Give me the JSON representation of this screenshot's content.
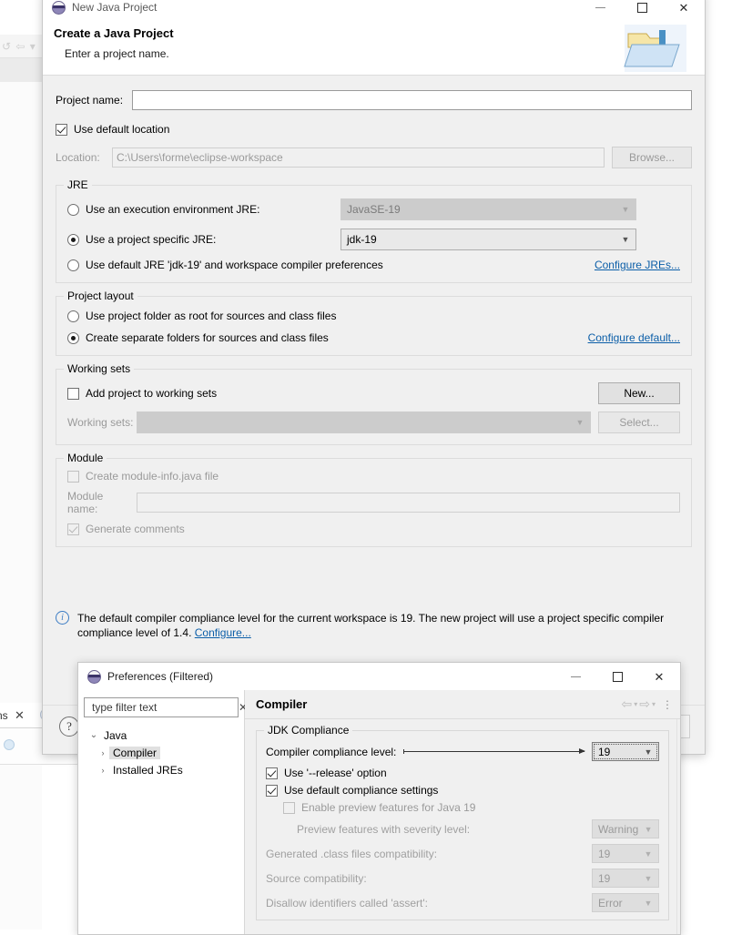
{
  "background": {
    "editor_tab_label": "ns",
    "editor_tab_close": "✕",
    "toolbar_glyphs": "↺ ⇦ ▾"
  },
  "wizard": {
    "window_title": "New Java Project",
    "window_icon": "eclipse-icon",
    "controls": {
      "minimize": "—",
      "maximize": "□",
      "close": "✕"
    },
    "header": {
      "title": "Create a Java Project",
      "subtitle": "Enter a project name.",
      "banner_icon": "java-project-folder-icon"
    },
    "project_name": {
      "label": "Project name:",
      "value": "",
      "placeholder": ""
    },
    "use_default_location": {
      "label": "Use default location",
      "checked": true
    },
    "location": {
      "label": "Location:",
      "value": "C:\\Users\\forme\\eclipse-workspace",
      "browse_label": "Browse...",
      "enabled": false
    },
    "jre": {
      "group_title": "JRE",
      "option_execution_env": {
        "label": "Use an execution environment JRE:",
        "selected": false,
        "combo_value": "JavaSE-19",
        "combo_enabled": false
      },
      "option_project_specific": {
        "label": "Use a project specific JRE:",
        "selected": true,
        "combo_value": "jdk-19",
        "combo_enabled": true
      },
      "option_default_jre": {
        "label": "Use default JRE 'jdk-19' and workspace compiler preferences",
        "selected": false
      },
      "configure_link": "Configure JREs..."
    },
    "project_layout": {
      "group_title": "Project layout",
      "option_project_folder_root": {
        "label": "Use project folder as root for sources and class files",
        "selected": false
      },
      "option_separate_folders": {
        "label": "Create separate folders for sources and class files",
        "selected": true
      },
      "configure_link": "Configure default..."
    },
    "working_sets": {
      "group_title": "Working sets",
      "add_to_working_sets": {
        "label": "Add project to working sets",
        "checked": false
      },
      "new_button": "New...",
      "working_sets_label": "Working sets:",
      "working_sets_value": "",
      "select_button": "Select...",
      "enabled": false
    },
    "module": {
      "group_title": "Module",
      "create_module_info": {
        "label": "Create module-info.java file",
        "checked": false,
        "enabled": false
      },
      "module_name_label": "Module name:",
      "module_name_value": "",
      "generate_comments": {
        "label": "Generate comments",
        "checked": true,
        "enabled": false
      }
    },
    "info_message": {
      "icon": "info-icon",
      "text": "The default compiler compliance level for the current workspace is 19. The new project will use a project specific compiler compliance level of 1.4.",
      "link": "Configure..."
    },
    "footer": {
      "help_icon": "?"
    }
  },
  "preferences": {
    "window_title": "Preferences (Filtered)",
    "window_icon": "eclipse-icon",
    "controls": {
      "minimize": "—",
      "maximize": "□",
      "close": "✕"
    },
    "filter": {
      "value": "type filter text",
      "clear_icon": "✕"
    },
    "tree": [
      {
        "label": "Java",
        "twisty": "⌄",
        "level": 0,
        "selected": false
      },
      {
        "label": "Compiler",
        "twisty": "›",
        "level": 1,
        "selected": true
      },
      {
        "label": "Installed JREs",
        "twisty": "›",
        "level": 1,
        "selected": false
      }
    ],
    "page_title": "Compiler",
    "nav": {
      "back_icon": "⇦",
      "back_caret": "▾",
      "forward_icon": "⇨",
      "forward_caret": "▾",
      "menu_icon": "⋮"
    },
    "jdk_compliance": {
      "group_title": "JDK Compliance",
      "compliance_level": {
        "label": "Compiler compliance level:",
        "value": "19",
        "focused": true
      },
      "use_release_option": {
        "label": "Use '--release' option",
        "checked": true
      },
      "use_default_compliance": {
        "label": "Use default compliance settings",
        "checked": true
      },
      "enable_preview": {
        "label": "Enable preview features for Java 19",
        "checked": false,
        "enabled": false
      },
      "preview_severity": {
        "label": "Preview features with severity level:",
        "value": "Warning",
        "enabled": false
      },
      "class_files_compat": {
        "label": "Generated .class files compatibility:",
        "value": "19",
        "enabled": false
      },
      "source_compat": {
        "label": "Source compatibility:",
        "value": "19",
        "enabled": false
      },
      "disallow_assert": {
        "label": "Disallow identifiers called 'assert':",
        "value": "Error",
        "enabled": false
      }
    }
  }
}
